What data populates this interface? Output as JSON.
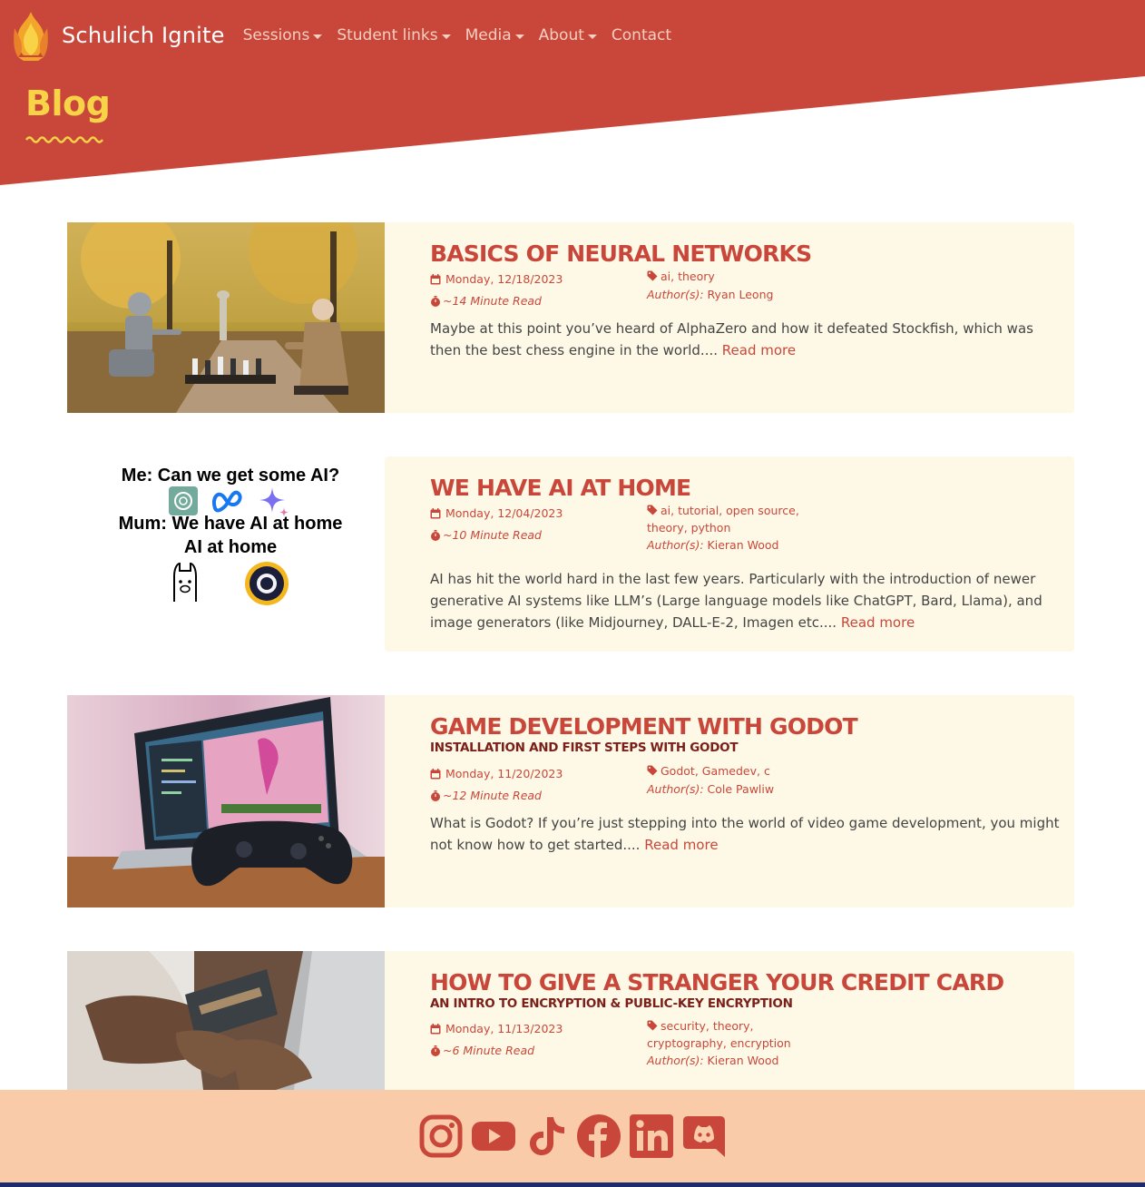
{
  "brand": {
    "name": "Schulich Ignite"
  },
  "nav": {
    "items": [
      {
        "label": "Sessions",
        "dropdown": true
      },
      {
        "label": "Student links",
        "dropdown": true
      },
      {
        "label": "Media",
        "dropdown": true
      },
      {
        "label": "About",
        "dropdown": true
      },
      {
        "label": "Contact",
        "dropdown": false
      }
    ]
  },
  "page": {
    "title": "Blog"
  },
  "colors": {
    "header": "#c9473a",
    "title": "#f8d247",
    "card": "#fef9e6",
    "footer": "#f9cba8",
    "accent": "#c9473a"
  },
  "posts": [
    {
      "title": "Basics of Neural Networks",
      "subtitle": "",
      "date": "Monday, 12/18/2023",
      "read_time": "~14 Minute Read",
      "tags": "ai, theory",
      "author_label": "Author(s):",
      "author": "Ryan Leong",
      "excerpt": "Maybe at this point you’ve heard of AlphaZero and how it defeated Stockfish, which was then the best chess engine in the world....",
      "read_more": "Read more"
    },
    {
      "title": "We have AI at home",
      "subtitle": "",
      "date": "Monday, 12/04/2023",
      "read_time": "~10 Minute Read",
      "tags": "ai, tutorial, open source, theory, python",
      "author_label": "Author(s):",
      "author": "Kieran Wood",
      "excerpt": "AI has hit the world hard in the last few years. Particularly with the introduction of newer generative AI systems like LLM’s (Large language models like ChatGPT, Bard, Llama), and image generators (like Midjourney, DALL-E-2, Imagen etc....",
      "read_more": "Read more",
      "meme": {
        "line1": "Me: Can we get some AI?",
        "line2": "Mum: We have AI at home",
        "line3": "AI at home"
      }
    },
    {
      "title": "Game Development with Godot",
      "subtitle": "Installation and first steps with Godot",
      "date": "Monday, 11/20/2023",
      "read_time": "~12 Minute Read",
      "tags": "Godot, Gamedev, c",
      "author_label": "Author(s):",
      "author": "Cole Pawliw",
      "excerpt": "What is Godot? If you’re just stepping into the world of video game development, you might not know how to get started....",
      "read_more": "Read more"
    },
    {
      "title": "How to give a stranger your credit card",
      "subtitle": "An intro to encryption & public-key encryption",
      "date": "Monday, 11/13/2023",
      "read_time": "~6 Minute Read",
      "tags": "security, theory, cryptography, encryption",
      "author_label": "Author(s):",
      "author": "Kieran Wood"
    }
  ],
  "footer": {
    "social": [
      "instagram-icon",
      "youtube-icon",
      "tiktok-icon",
      "facebook-icon",
      "linkedin-icon",
      "discord-icon"
    ]
  }
}
